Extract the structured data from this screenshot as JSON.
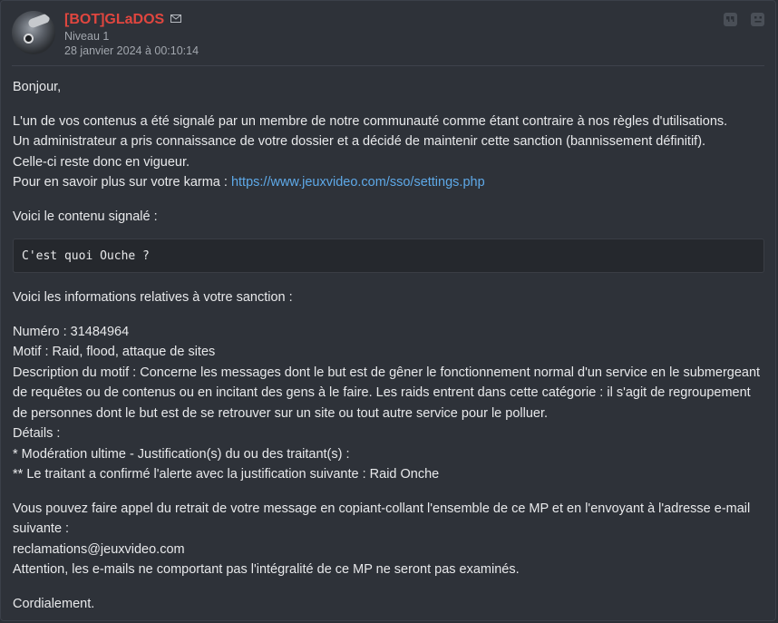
{
  "header": {
    "author": "[BOT]GLaDOS",
    "level": "Niveau 1",
    "date": "28 janvier 2024 à 00:10:14"
  },
  "icons": {
    "mail": "envelope-icon",
    "quote": "quote-icon",
    "report": "report-icon"
  },
  "colors": {
    "author": "#e0463f",
    "link": "#5ea9e8",
    "background": "#2e3239"
  },
  "message": {
    "greeting": "Bonjour,",
    "intro_line1": "L'un de vos contenus a été signalé par un membre de notre communauté comme étant contraire à nos règles d'utilisations.",
    "intro_line2": "Un administrateur a pris connaissance de votre dossier et a décidé de maintenir cette sanction (bannissement définitif).",
    "intro_line3": "Celle-ci reste donc en vigueur.",
    "karma_prefix": "Pour en savoir plus sur votre karma : ",
    "karma_link": "https://www.jeuxvideo.com/sso/settings.php",
    "reported_title": "Voici le contenu signalé :",
    "reported_content": "C'est quoi Ouche ?",
    "sanction_title": "Voici les informations relatives à votre sanction :",
    "numero": "Numéro : 31484964",
    "motif": "Motif : Raid, flood, attaque de sites",
    "description": "Description du motif : Concerne les messages dont le but est de gêner le fonctionnement normal d'un service en le submergeant de requêtes ou de contenus ou en incitant des gens à le faire. Les raids entrent dans cette catégorie : il s'agit de regroupement de personnes dont le but est de se retrouver sur un site ou tout autre service pour le polluer.",
    "details": "Détails :",
    "details_line1": "* Modération ultime - Justification(s) du ou des traitant(s) :",
    "details_line2": "** Le traitant a confirmé l'alerte avec la justification suivante : Raid Onche",
    "appeal": "Vous pouvez faire appel du retrait de votre message en copiant-collant l'ensemble de ce MP et en l'envoyant à l'adresse e-mail suivante :",
    "email": "reclamations@jeuxvideo.com",
    "warning": "Attention, les e-mails ne comportant pas l'intégralité de ce MP ne seront pas examinés.",
    "closing": "Cordialement."
  }
}
